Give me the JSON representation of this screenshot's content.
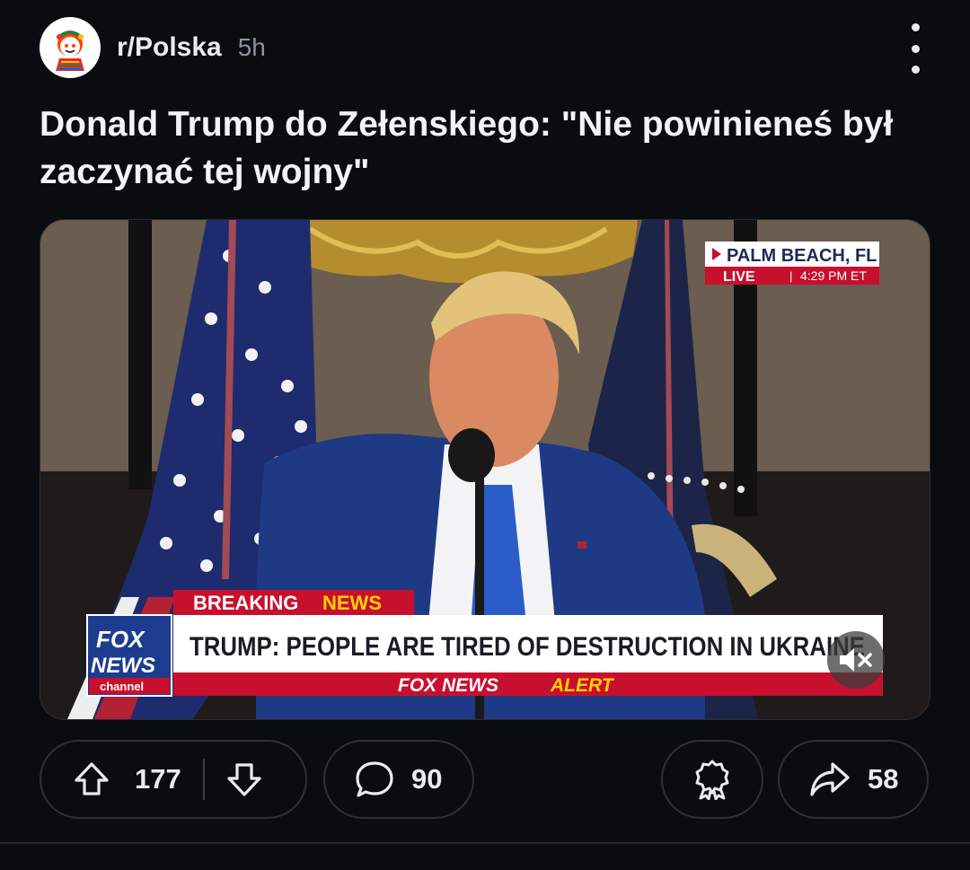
{
  "post": {
    "subreddit": "r/Polska",
    "age": "5h",
    "title": "Donald Trump do Zełenskiego: \"Nie powinieneś był zaczynać tej wojny\""
  },
  "video": {
    "location": "PALM BEACH, FL",
    "live_label": "LIVE",
    "time": "4:29 PM ET",
    "breaking_label_1": "BREAKING",
    "breaking_label_2": "NEWS",
    "headline": "TRUMP: PEOPLE ARE TIRED OF DESTRUCTION IN UKRAINE",
    "alert_label_1": "FOX NEWS",
    "alert_label_2": "ALERT",
    "logo_line_1": "FOX",
    "logo_line_2": "NEWS",
    "logo_line_3": "channel",
    "muted": true
  },
  "actions": {
    "upvotes": "177",
    "comments": "90",
    "shares": "58"
  },
  "icons": {
    "more": "more-vertical-icon",
    "upvote": "upvote-arrow-icon",
    "downvote": "downvote-arrow-icon",
    "comment": "comment-bubble-icon",
    "award": "award-icon",
    "share": "share-arrow-icon",
    "mute": "muted-speaker-icon"
  },
  "colors": {
    "background": "#0b0c0f",
    "text": "#e9ecef",
    "muted_text": "#8a94a0",
    "pill_border": "#2d3035",
    "fox_red": "#c8102e",
    "fox_yellow": "#ffd200"
  }
}
